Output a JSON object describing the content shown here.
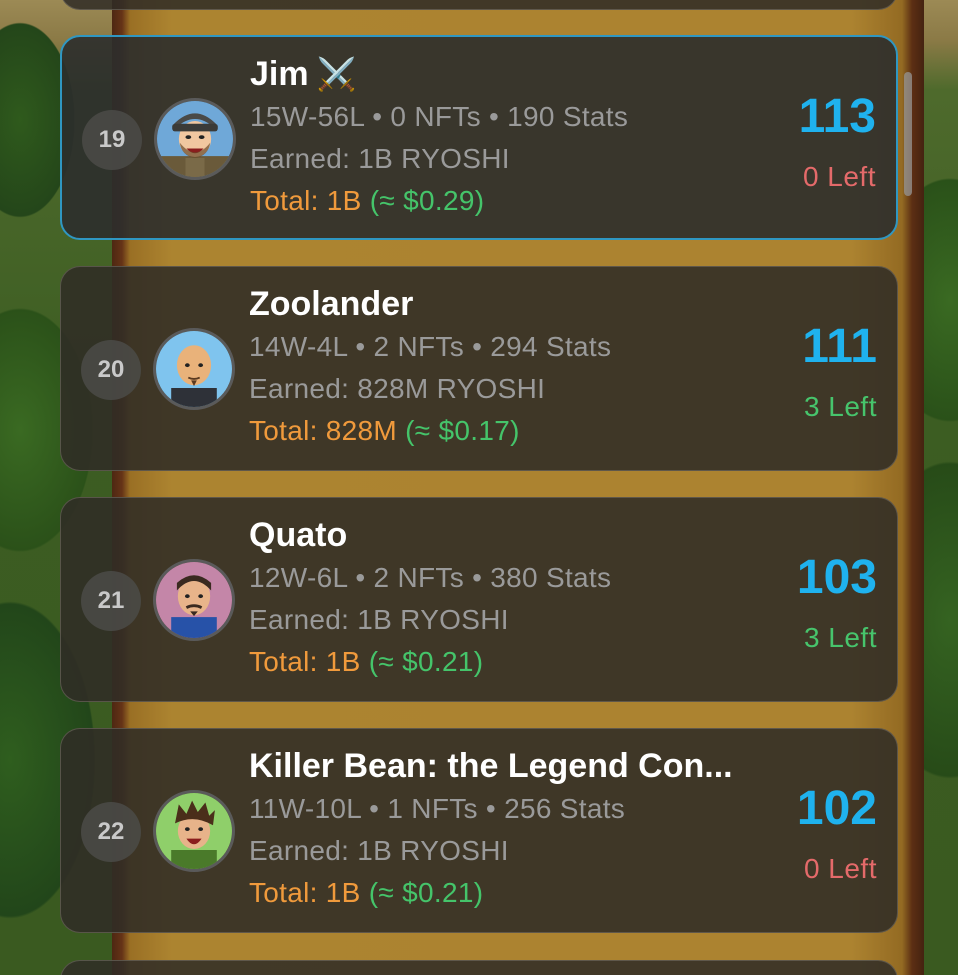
{
  "leaderboard": [
    {
      "rank": "19",
      "name": "Jim",
      "badge_icon": "crossed-swords-icon",
      "badge_glyph": "⚔️",
      "stats": "15W-56L • 0 NFTs • 190 Stats",
      "earned": "Earned: 1B RYOSHI",
      "total_label": "Total: 1B",
      "total_usd": "(≈ $0.29)",
      "score": "113",
      "left": "0 Left",
      "left_status": "red",
      "selected": true
    },
    {
      "rank": "20",
      "name": "Zoolander",
      "stats": "14W-4L • 2 NFTs • 294 Stats",
      "earned": "Earned: 828M RYOSHI",
      "total_label": "Total: 828M",
      "total_usd": "(≈ $0.17)",
      "score": "111",
      "left": "3 Left",
      "left_status": "green",
      "selected": false
    },
    {
      "rank": "21",
      "name": "Quato",
      "stats": "12W-6L • 2 NFTs • 380 Stats",
      "earned": "Earned: 1B RYOSHI",
      "total_label": "Total: 1B",
      "total_usd": "(≈ $0.21)",
      "score": "103",
      "left": "3 Left",
      "left_status": "green",
      "selected": false
    },
    {
      "rank": "22",
      "name": "Killer Bean: the Legend Con...",
      "stats": "11W-10L • 1 NFTs • 256 Stats",
      "earned": "Earned: 1B RYOSHI",
      "total_label": "Total: 1B",
      "total_usd": "(≈ $0.21)",
      "score": "102",
      "left": "0 Left",
      "left_status": "red",
      "selected": false
    }
  ],
  "colors": {
    "score": "#1fb2ee",
    "total": "#f09a3c",
    "usd": "#45c46a",
    "left_red": "#e46a6a",
    "left_green": "#47c46c",
    "selected_border": "#2f97c2"
  }
}
